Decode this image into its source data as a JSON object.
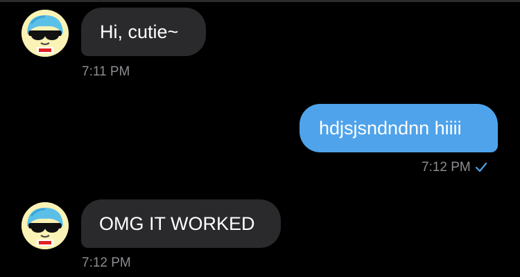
{
  "chat": {
    "messages": [
      {
        "direction": "incoming",
        "text": "Hi, cutie~",
        "time": "7:11 PM",
        "avatar_icon": "cartoon-sunglasses-avatar-icon"
      },
      {
        "direction": "outgoing",
        "text": "hdjsjsndndnn hiiii",
        "time": "7:12 PM",
        "status_icon": "checkmark-icon"
      },
      {
        "direction": "incoming",
        "text": "OMG IT WORKED",
        "time": "7:12 PM",
        "avatar_icon": "cartoon-sunglasses-avatar-icon"
      }
    ]
  },
  "colors": {
    "background": "#000000",
    "incoming_bubble": "#2a2a2c",
    "outgoing_bubble": "#4fa3ea",
    "timestamp": "#8d8d92",
    "check": "#4fa3ea"
  }
}
